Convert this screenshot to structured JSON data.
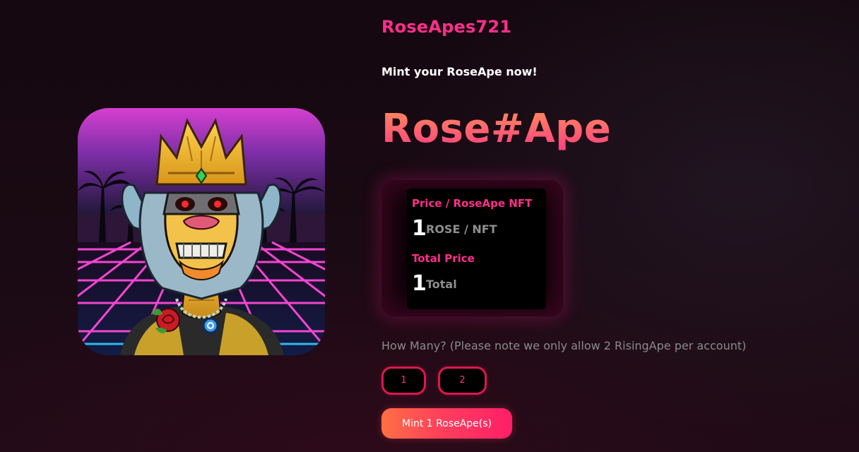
{
  "header": {
    "brand": "RoseApes721",
    "tagline": "Mint your RoseApe now!"
  },
  "hero": {
    "title": "Rose#Ape"
  },
  "price_panel": {
    "unit_price_label": "Price / RoseApe NFT",
    "unit_price_value": "1",
    "unit_price_unit": "ROSE / NFT",
    "total_label": "Total Price",
    "total_value": "1",
    "total_unit": "Total"
  },
  "quantity": {
    "prompt": "How Many? (Please note we only allow 2 RisingApe per account)",
    "options": [
      "1",
      "2"
    ]
  },
  "mint": {
    "button_label": "Mint 1 RoseApe(s)"
  },
  "colors": {
    "accent_pink": "#ff2f8a",
    "button_gradient_start": "#ff6f43",
    "button_gradient_end": "#ff1f68",
    "button_border": "#d9184f"
  },
  "nft_image": {
    "icon": "crowned-ape-nft-artwork"
  }
}
